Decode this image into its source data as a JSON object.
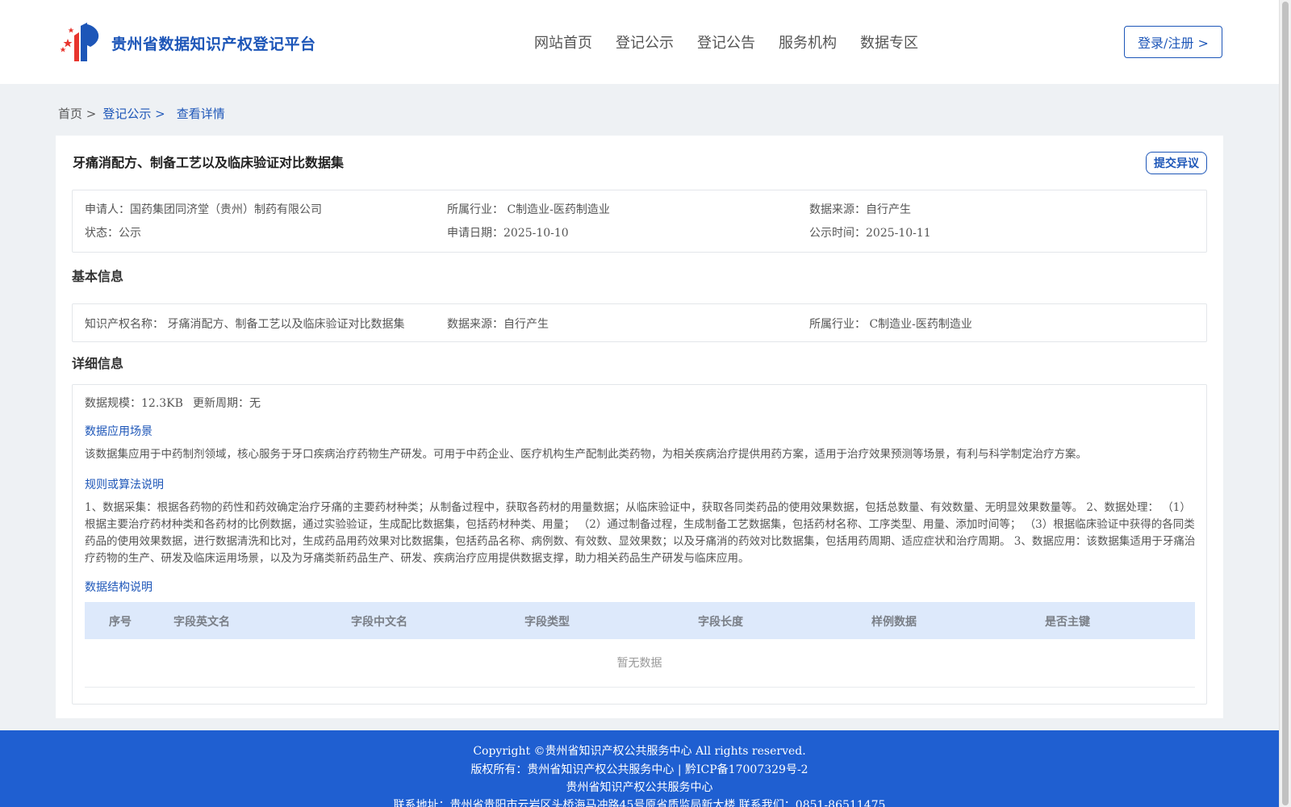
{
  "header": {
    "logo_text": "贵州省数据知识产权登记平台",
    "nav": [
      "网站首页",
      "登记公示",
      "登记公告",
      "服务机构",
      "数据专区"
    ],
    "login_label": "登录/注册 >"
  },
  "breadcrumb": {
    "home": "首页 >",
    "link": "登记公示 >",
    "current": "查看详情"
  },
  "record": {
    "title": "牙痛消配方、制备工艺以及临床验证对比数据集",
    "objection_label": "提交异议",
    "applicant": "申请人：国药集团同济堂（贵州）制药有限公司",
    "industry": "所属行业： C制造业-医药制造业",
    "source": "数据来源：自行产生",
    "status": "状态：公示",
    "apply_date": "申请日期：2025-10-10",
    "publish_date": "公示时间：2025-10-11"
  },
  "basic": {
    "section_title": "基本信息",
    "ip_name": "知识产权名称： 牙痛消配方、制备工艺以及临床验证对比数据集",
    "source": "数据来源：自行产生",
    "industry": "所属行业： C制造业-医药制造业"
  },
  "detail": {
    "section_title": "详细信息",
    "scale": "数据规模：12.3KB",
    "cycle": "更新周期：无",
    "scenario_title": "数据应用场景",
    "scenario_text": "该数据集应用于中药制剂领域，核心服务于牙口疾病治疗药物生产研发。可用于中药企业、医疗机构生产配制此类药物，为相关疾病治疗提供用药方案，适用于治疗效果预测等场景，有利与科学制定治疗方案。",
    "rules_title": "规则或算法说明",
    "rules_text": "1、数据采集：根据各药物的药性和药效确定治疗牙痛的主要药材种类；从制备过程中，获取各药材的用量数据；从临床验证中，获取各同类药品的使用效果数据，包括总数量、有效数量、无明显效果数量等。 2、数据处理： （1）根据主要治疗药材种类和各药材的比例数据，通过实验验证，生成配比数据集，包括药材种类、用量； （2）通过制备过程，生成制备工艺数据集，包括药材名称、工序类型、用量、添加时间等； （3）根据临床验证中获得的各同类药品的使用效果数据，进行数据清洗和比对，生成药品用药效果对比数据集，包括药品名称、病例数、有效数、显效果数；以及牙痛消的药效对比数据集，包括用药周期、适应症状和治疗周期。 3、数据应用：该数据集适用于牙痛治疗药物的生产、研发及临床运用场景，以及为牙痛类新药品生产、研发、疾病治疗应用提供数据支撑，助力相关药品生产研发与临床应用。",
    "structure_title": "数据结构说明",
    "columns": [
      "序号",
      "字段英文名",
      "字段中文名",
      "字段类型",
      "字段长度",
      "样例数据",
      "是否主键"
    ],
    "empty_text": "暂无数据"
  },
  "footer": {
    "line1": "Copyright ©贵州省知识产权公共服务中心 All rights reserved.",
    "line2": "版权所有：贵州省知识产权公共服务中心 | 黔ICP备17007329号-2",
    "line3": "贵州省知识产权公共服务中心",
    "line4": "联系地址：贵州省贵阳市云岩区头桥海马冲路45号原省质监局新大楼 联系我们：0851-86511475"
  },
  "colors": {
    "brand": "#1d56b8",
    "footer_bg": "#1f5fd1",
    "table_head_bg": "#dde9fb"
  }
}
